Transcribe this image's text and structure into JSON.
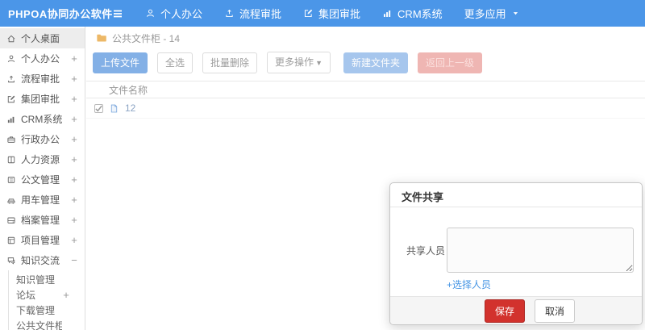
{
  "header": {
    "logo": "PHPOA协同办公软件",
    "nav": [
      {
        "label": "个人办公",
        "icon": "user-icon"
      },
      {
        "label": "流程审批",
        "icon": "upload-icon"
      },
      {
        "label": "集团审批",
        "icon": "edit-icon"
      },
      {
        "label": "CRM系统",
        "icon": "chart-icon"
      },
      {
        "label": "更多应用",
        "trailing_icon": "caret-down-icon"
      }
    ]
  },
  "sidebar": {
    "items": [
      {
        "label": "个人桌面",
        "icon": "home-icon",
        "active": true
      },
      {
        "label": "个人办公",
        "icon": "user-icon",
        "expandable": true
      },
      {
        "label": "流程审批",
        "icon": "upload-icon",
        "expandable": true
      },
      {
        "label": "集团审批",
        "icon": "edit-icon",
        "expandable": true
      },
      {
        "label": "CRM系统",
        "icon": "chart-icon",
        "expandable": true
      },
      {
        "label": "行政办公",
        "icon": "briefcase-icon",
        "expandable": true
      },
      {
        "label": "人力资源",
        "icon": "book-icon",
        "expandable": true
      },
      {
        "label": "公文管理",
        "icon": "document-icon",
        "expandable": true
      },
      {
        "label": "用车管理",
        "icon": "car-icon",
        "expandable": true
      },
      {
        "label": "档案管理",
        "icon": "archive-icon",
        "expandable": true
      },
      {
        "label": "项目管理",
        "icon": "project-icon",
        "expandable": true
      },
      {
        "label": "知识交流",
        "icon": "chat-icon",
        "expanded": true
      }
    ],
    "subitems": [
      {
        "label": "知识管理"
      },
      {
        "label": "论坛",
        "expandable": true
      },
      {
        "label": "下载管理"
      },
      {
        "label": "公共文件柜"
      }
    ]
  },
  "breadcrumb": {
    "label": "公共文件柜 - 14"
  },
  "toolbar": {
    "upload": "上传文件",
    "select_all": "全选",
    "batch_delete": "批量删除",
    "more_actions": "更多操作",
    "new_folder": "新建文件夹",
    "go_back": "返回上一级"
  },
  "table": {
    "name_header": "文件名称",
    "rows": [
      {
        "name": "12",
        "checked": true
      }
    ]
  },
  "modal": {
    "title": "文件共享",
    "field_label": "共享人员",
    "textarea_value": "",
    "select_link": "+选择人员",
    "save": "保存",
    "cancel": "取消"
  },
  "colors": {
    "header_blue": "#4b96e8",
    "link_blue": "#4494e4",
    "save_red": "#d2322d",
    "folder_yellow": "#edb867",
    "upload_btn_blue": "#83b0e6",
    "new_folder_btn_blue": "#a6c6ed",
    "back_btn_red": "#efb6b3"
  }
}
